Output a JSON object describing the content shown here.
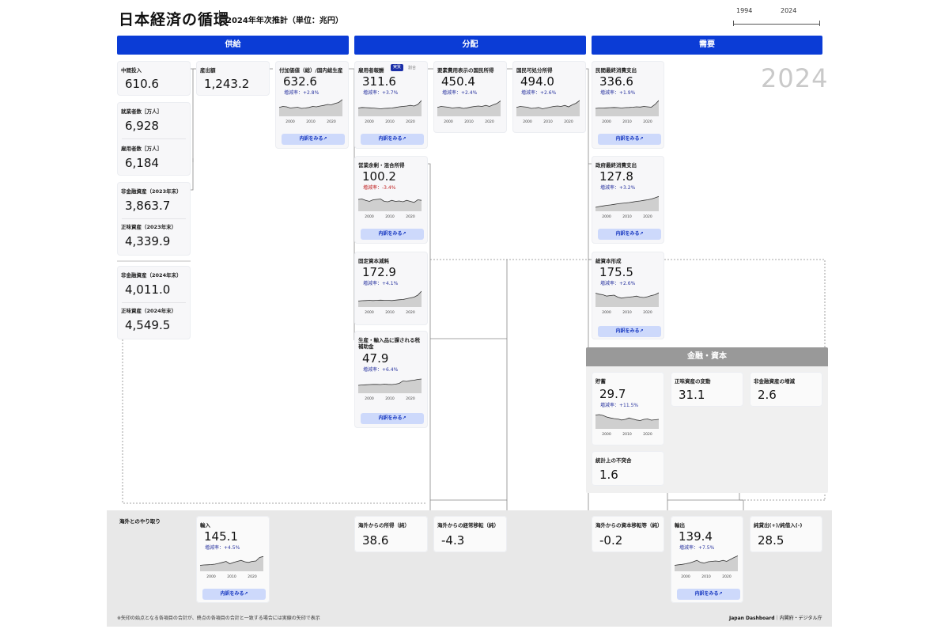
{
  "header": {
    "title": "日本経済の循環",
    "subtitle": "2024年年次推計（単位：兆円）",
    "range_start": "1994",
    "range_end": "2024",
    "year_display": "2024"
  },
  "sections": {
    "supply": "供給",
    "distribution": "分配",
    "demand": "需要",
    "finance": "金融・資本",
    "overseas": "海外とのやり取り"
  },
  "supply": {
    "intermediate_input": {
      "label": "中間投入",
      "value": "610.6"
    },
    "output": {
      "label": "産出額",
      "value": "1,243.2"
    },
    "gva": {
      "label": "付加価値（総）/国内総生産",
      "value": "632.6",
      "rate": "増減率：+2.8%"
    },
    "employed": {
      "label": "就業者数［万人］",
      "value": "6,928"
    },
    "employees": {
      "label": "雇用者数［万人］",
      "value": "6,184"
    },
    "nonfin_2023": {
      "label": "非金融資産（2023年末）",
      "value": "3,863.7"
    },
    "networth_2023": {
      "label": "正味資産（2023年末）",
      "value": "4,339.9"
    },
    "nonfin_2024": {
      "label": "非金融資産（2024年末）",
      "value": "4,011.0"
    },
    "networth_2024": {
      "label": "正味資産（2024年末）",
      "value": "4,549.5"
    }
  },
  "distribution": {
    "compensation": {
      "label": "雇用者報酬",
      "tag_active": "実質",
      "tag_inactive": "割合",
      "value": "311.6",
      "rate": "増減率：+3.7%"
    },
    "factor_income": {
      "label": "要素費用表示の国民所得",
      "value": "450.4",
      "rate": "増減率：+2.4%"
    },
    "disposable_income": {
      "label": "国民可処分所得",
      "value": "494.0",
      "rate": "増減率：+2.6%"
    },
    "operating_surplus": {
      "label": "営業余剰・混合所得",
      "value": "100.2",
      "rate": "増減率：-3.4%"
    },
    "depreciation": {
      "label": "固定資本減耗",
      "value": "172.9",
      "rate": "増減率：+4.1%"
    },
    "taxes": {
      "label": "生産・輸入品に課される税",
      "label2": "補助金",
      "value": "47.9",
      "rate": "増減率：+6.4%"
    }
  },
  "demand": {
    "private_consumption": {
      "label": "民間最終消費支出",
      "value": "336.6",
      "rate": "増減率：+1.9%"
    },
    "gov_consumption": {
      "label": "政府最終消費支出",
      "value": "127.8",
      "rate": "増減率：+3.2%"
    },
    "capital_formation": {
      "label": "総資本形成",
      "value": "175.5",
      "rate": "増減率：+2.6%"
    }
  },
  "finance": {
    "saving": {
      "label": "貯蓄",
      "value": "29.7",
      "rate": "増減率：+11.5%"
    },
    "networth_change": {
      "label": "正味資産の変動",
      "value": "31.1"
    },
    "nonfin_increase": {
      "label": "非金融資産の増減",
      "value": "2.6"
    },
    "discrepancy": {
      "label": "統計上の不突合",
      "value": "1.6"
    }
  },
  "overseas": {
    "imports": {
      "label": "輸入",
      "value": "145.1",
      "rate": "増減率：+4.5%"
    },
    "income_from_abroad": {
      "label": "海外からの所得（純）",
      "value": "38.6"
    },
    "current_transfers": {
      "label": "海外からの経常移転（純）",
      "value": "-4.3"
    },
    "capital_transfers": {
      "label": "海外からの資本移転等（純）",
      "value": "-0.2"
    },
    "exports": {
      "label": "輸出",
      "value": "139.4",
      "rate": "増減率：+7.5%"
    },
    "net_lending": {
      "label": "純貸出(+)/純借入(-)",
      "value": "28.5"
    }
  },
  "buttons": {
    "breakdown": "内訳をみる↗"
  },
  "axis_years": [
    "2000",
    "2010",
    "2020"
  ],
  "footer": {
    "note": "※矢印の始点となる各項目の合計が、終点の各項目の合計と一致する場合には実線の矢印で表示",
    "brand": "Japan Dashboard",
    "credit": "｜内閣府・デジタル庁"
  },
  "colors": {
    "accent": "#0b3cd6",
    "finance_header": "#999999",
    "button_bg": "#cdd9fb",
    "spark_fill": "#cfcfcf"
  },
  "sparklines": {
    "gva": [
      0.45,
      0.5,
      0.48,
      0.42,
      0.44,
      0.46,
      0.4,
      0.42,
      0.45,
      0.5,
      0.48,
      0.52,
      0.55,
      0.6,
      0.58,
      0.65,
      0.7,
      0.85
    ],
    "compensation": [
      0.42,
      0.45,
      0.44,
      0.43,
      0.42,
      0.4,
      0.38,
      0.4,
      0.41,
      0.42,
      0.45,
      0.48,
      0.5,
      0.52,
      0.55,
      0.52,
      0.6,
      0.8
    ],
    "factor_income": [
      0.45,
      0.5,
      0.48,
      0.46,
      0.42,
      0.44,
      0.45,
      0.4,
      0.43,
      0.47,
      0.5,
      0.52,
      0.5,
      0.55,
      0.5,
      0.58,
      0.65,
      0.78
    ],
    "disposable_income": [
      0.45,
      0.5,
      0.48,
      0.46,
      0.4,
      0.42,
      0.45,
      0.38,
      0.42,
      0.46,
      0.5,
      0.52,
      0.5,
      0.55,
      0.48,
      0.58,
      0.66,
      0.8
    ],
    "private_consumption": [
      0.4,
      0.42,
      0.42,
      0.43,
      0.44,
      0.45,
      0.44,
      0.42,
      0.44,
      0.45,
      0.46,
      0.48,
      0.47,
      0.5,
      0.48,
      0.46,
      0.6,
      0.8
    ],
    "operating_surplus": [
      0.6,
      0.62,
      0.55,
      0.5,
      0.58,
      0.6,
      0.62,
      0.5,
      0.48,
      0.55,
      0.5,
      0.52,
      0.48,
      0.55,
      0.5,
      0.45,
      0.58,
      0.55
    ],
    "gov_consumption": [
      0.2,
      0.24,
      0.27,
      0.3,
      0.32,
      0.35,
      0.38,
      0.4,
      0.42,
      0.44,
      0.47,
      0.5,
      0.52,
      0.55,
      0.58,
      0.62,
      0.68,
      0.75
    ],
    "depreciation": [
      0.3,
      0.32,
      0.33,
      0.34,
      0.33,
      0.34,
      0.35,
      0.34,
      0.34,
      0.33,
      0.35,
      0.37,
      0.38,
      0.42,
      0.46,
      0.5,
      0.6,
      0.8
    ],
    "capital_formation": [
      0.7,
      0.65,
      0.62,
      0.55,
      0.58,
      0.6,
      0.5,
      0.45,
      0.48,
      0.5,
      0.52,
      0.55,
      0.5,
      0.48,
      0.52,
      0.58,
      0.62,
      0.72
    ],
    "taxes": [
      0.4,
      0.42,
      0.43,
      0.44,
      0.45,
      0.45,
      0.44,
      0.46,
      0.45,
      0.44,
      0.46,
      0.5,
      0.62,
      0.6,
      0.64,
      0.66,
      0.7,
      0.72
    ],
    "saving": [
      0.7,
      0.72,
      0.68,
      0.6,
      0.55,
      0.52,
      0.5,
      0.45,
      0.48,
      0.55,
      0.5,
      0.45,
      0.42,
      0.48,
      0.5,
      0.44,
      0.46,
      0.48
    ],
    "imports": [
      0.3,
      0.32,
      0.33,
      0.34,
      0.36,
      0.4,
      0.45,
      0.5,
      0.38,
      0.45,
      0.5,
      0.55,
      0.48,
      0.45,
      0.5,
      0.52,
      0.7,
      0.75
    ],
    "exports": [
      0.3,
      0.33,
      0.35,
      0.38,
      0.42,
      0.48,
      0.55,
      0.45,
      0.42,
      0.48,
      0.5,
      0.52,
      0.5,
      0.55,
      0.5,
      0.6,
      0.7,
      0.78
    ]
  }
}
